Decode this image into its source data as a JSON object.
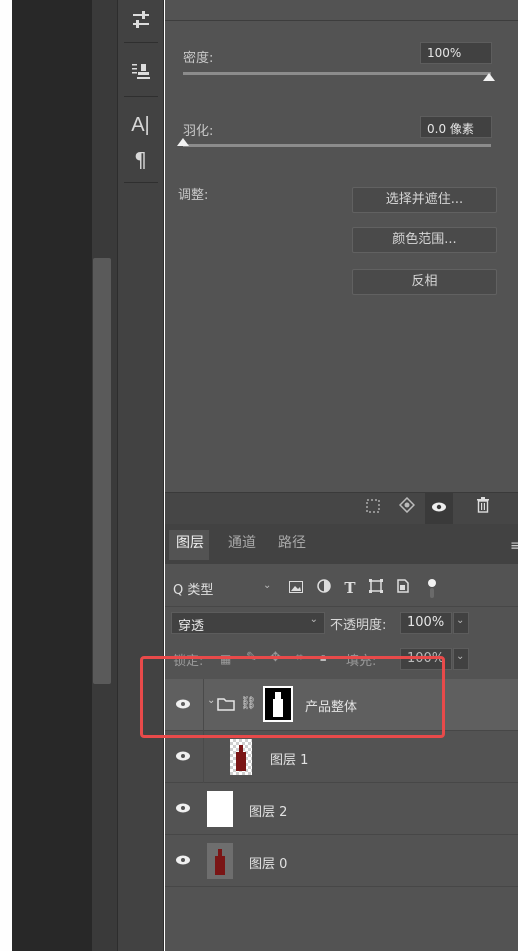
{
  "properties": {
    "density_label": "密度:",
    "density_value": "100%",
    "feather_label": "羽化:",
    "feather_value": "0.0 像素",
    "adjust_label": "调整:",
    "buttons": [
      "选择并遮住...",
      "颜色范围...",
      "反相"
    ]
  },
  "tool_column": {
    "text_tool": "A|",
    "paragraph": "¶"
  },
  "layers_panel": {
    "tabs": [
      "图层",
      "通道",
      "路径"
    ],
    "filter_label": "Q 类型",
    "blend_mode": "穿透",
    "opacity_label": "不透明度:",
    "opacity_value": "100%",
    "lock_label": "锁定:",
    "fill_label": "填充:",
    "fill_value": "100%",
    "layers": [
      {
        "name": "产品整体",
        "type": "group"
      },
      {
        "name": "图层 1",
        "type": "layer"
      },
      {
        "name": "图层 2",
        "type": "layer"
      },
      {
        "name": "图层 0",
        "type": "layer"
      }
    ]
  },
  "colors": {
    "highlight": "#e84a4a",
    "panel": "#535353",
    "bottle": "#7a1515"
  }
}
